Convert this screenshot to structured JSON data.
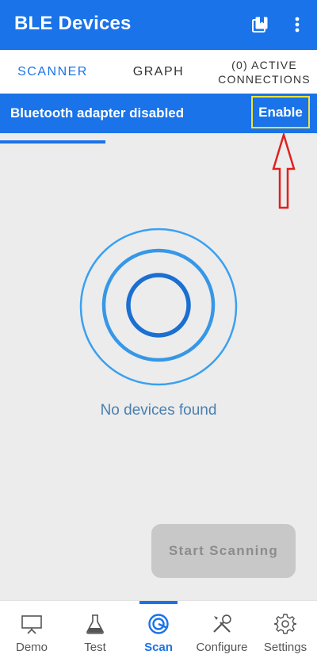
{
  "appbar": {
    "title": "BLE Devices",
    "bookmark_icon": "bookmark-stack-icon",
    "more_icon": "more-vert-icon"
  },
  "tabs": [
    {
      "label": "SCANNER"
    },
    {
      "label": "GRAPH"
    },
    {
      "label": "(0) ACTIVE CONNECTIONS"
    }
  ],
  "banner": {
    "message": "Bluetooth adapter disabled",
    "enable_label": "Enable"
  },
  "scanner": {
    "empty_text": "No devices found",
    "start_label": "Start Scanning"
  },
  "bottom_nav": [
    {
      "label": "Demo",
      "icon": "presentation-icon"
    },
    {
      "label": "Test",
      "icon": "flask-icon"
    },
    {
      "label": "Scan",
      "icon": "radar-icon",
      "active": true
    },
    {
      "label": "Configure",
      "icon": "tools-icon"
    },
    {
      "label": "Settings",
      "icon": "gear-icon"
    }
  ],
  "colors": {
    "primary": "#1a73e8",
    "highlight_box": "#f2e33b",
    "arrow": "#e02020"
  }
}
